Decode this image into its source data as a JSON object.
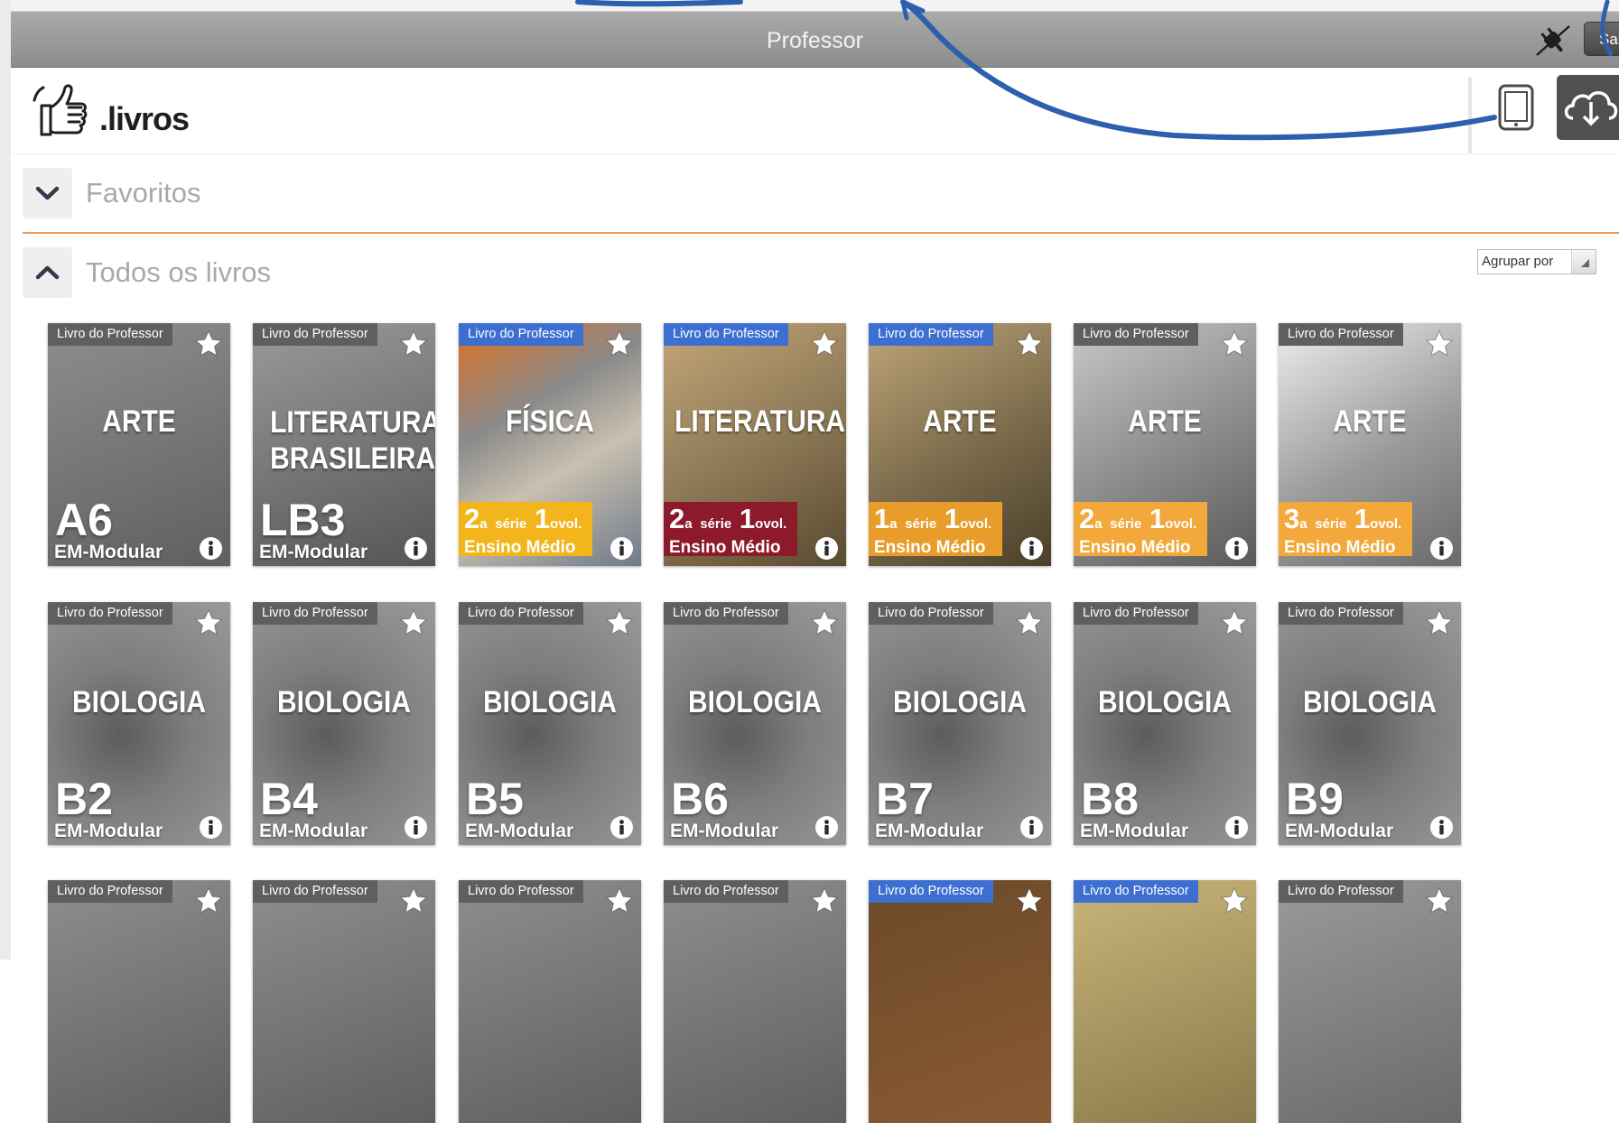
{
  "window": {
    "title": "Professor",
    "exit_label": "Sair"
  },
  "header": {
    "logo_text": ".livros"
  },
  "sections": {
    "favorites": {
      "title": "Favoritos"
    },
    "all_books": {
      "title": "Todos os livros",
      "group_by_label": "Agrupar por"
    }
  },
  "colors": {
    "accent_line": "#f09a4a",
    "badge_blue": "#3d6fd1",
    "badge_gray": "#5f5f5f"
  },
  "books": [
    {
      "badge": "Livro do Professor",
      "title": "ARTE",
      "code": "A6",
      "subtitle": "EM-Modular"
    },
    {
      "badge": "Livro do Professor",
      "title": "LITERATURA BRASILEIRA",
      "code": "LB3",
      "subtitle": "EM-Modular"
    },
    {
      "badge": "Livro do Professor",
      "title": "FÍSICA",
      "series_a": "2",
      "series_b": "1",
      "level": "Ensino Médio"
    },
    {
      "badge": "Livro do Professor",
      "title": "LITERATURA",
      "series_a": "2",
      "series_b": "1",
      "level": "Ensino Médio"
    },
    {
      "badge": "Livro do Professor",
      "title": "ARTE",
      "series_a": "1",
      "series_b": "1",
      "level": "Ensino Médio"
    },
    {
      "badge": "Livro do Professor",
      "title": "ARTE",
      "series_a": "2",
      "series_b": "1",
      "level": "Ensino Médio"
    },
    {
      "badge": "Livro do Professor",
      "title": "ARTE",
      "series_a": "3",
      "series_b": "1",
      "level": "Ensino Médio"
    },
    {
      "badge": "Livro do Professor",
      "title": "BIOLOGIA",
      "code": "B2",
      "subtitle": "EM-Modular"
    },
    {
      "badge": "Livro do Professor",
      "title": "BIOLOGIA",
      "code": "B4",
      "subtitle": "EM-Modular"
    },
    {
      "badge": "Livro do Professor",
      "title": "BIOLOGIA",
      "code": "B5",
      "subtitle": "EM-Modular"
    },
    {
      "badge": "Livro do Professor",
      "title": "BIOLOGIA",
      "code": "B6",
      "subtitle": "EM-Modular"
    },
    {
      "badge": "Livro do Professor",
      "title": "BIOLOGIA",
      "code": "B7",
      "subtitle": "EM-Modular"
    },
    {
      "badge": "Livro do Professor",
      "title": "BIOLOGIA",
      "code": "B8",
      "subtitle": "EM-Modular"
    },
    {
      "badge": "Livro do Professor",
      "title": "BIOLOGIA",
      "code": "B9",
      "subtitle": "EM-Modular"
    },
    {
      "badge": "Livro do Professor"
    },
    {
      "badge": "Livro do Professor"
    },
    {
      "badge": "Livro do Professor"
    },
    {
      "badge": "Livro do Professor"
    },
    {
      "badge": "Livro do Professor"
    },
    {
      "badge": "Livro do Professor"
    },
    {
      "badge": "Livro do Professor"
    }
  ],
  "series_labels": {
    "serie": "série",
    "vol": "vol.",
    "ordinal_a": "a",
    "ordinal_o": "o"
  }
}
